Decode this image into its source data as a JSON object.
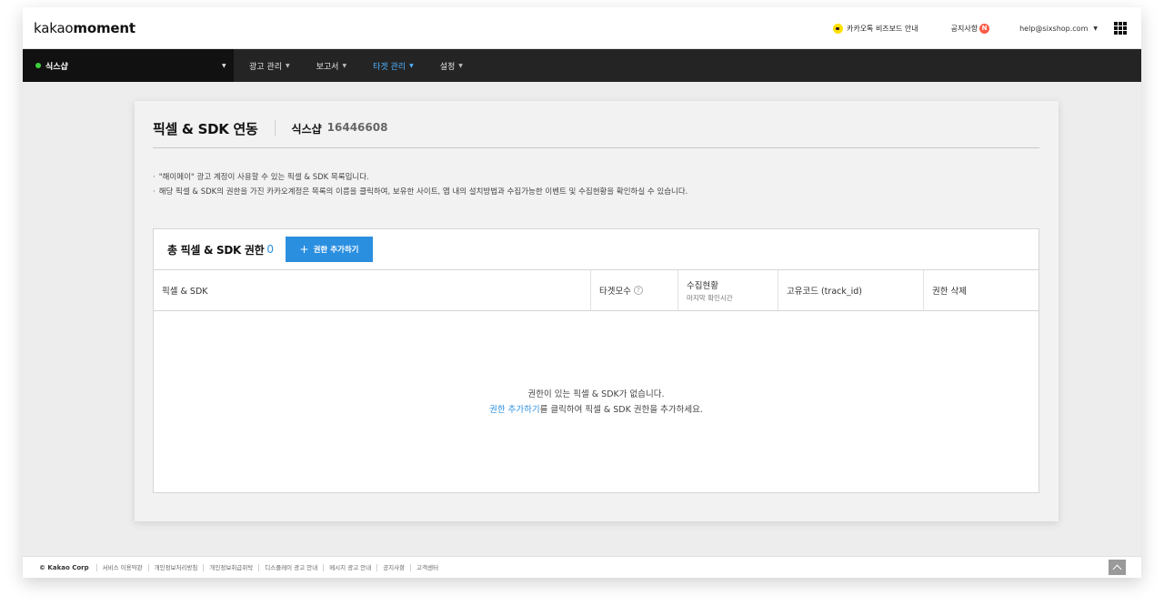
{
  "header": {
    "logo_regular": "kakao",
    "logo_bold": "moment",
    "biz_board_label": "카카오톡 비즈보드 안내",
    "notice_label": "공지사항",
    "notice_badge": "N",
    "account_email": "help@sixshop.com"
  },
  "nav": {
    "account_name": "식스샵",
    "items": [
      {
        "label": "광고 관리",
        "active": false
      },
      {
        "label": "보고서",
        "active": false
      },
      {
        "label": "타겟 관리",
        "active": true
      },
      {
        "label": "설정",
        "active": false
      }
    ]
  },
  "page": {
    "title": "픽셀 & SDK 연동",
    "account_name": "식스샵",
    "account_id": "16446608",
    "descriptions": [
      "\"해이메이\" 광고 계정이 사용할 수 있는 픽셀 & SDK 목록입니다.",
      "해당 픽셀 & SDK의 권한을 가진 카카오계정은 목록의 이름을 클릭하여, 보유한 사이트, 앱 내의 설치방법과 수집가능한 이벤트 및 수집현황을 확인하실 수 있습니다."
    ]
  },
  "table": {
    "title": "총 픽셀 & SDK 권한",
    "count": "0",
    "add_button": "권한 추가하기",
    "columns": {
      "name": "픽셀 & SDK",
      "target": "타겟모수",
      "status": "수집현황",
      "status_sub": "마지막 확인시간",
      "track_id": "고유코드 (track_id)",
      "delete": "권한 삭제"
    },
    "empty_line1": "권한이 있는 픽셀 & SDK가 없습니다.",
    "empty_link": "권한 추가하기",
    "empty_line2_rest": "를 클릭하여 픽셀 & SDK 권한을 추가하세요."
  },
  "footer": {
    "copyright": "© Kakao Corp",
    "links": [
      "서비스 이용약관",
      "개인정보처리방침",
      "개인정보취급위탁",
      "디스플레이 광고 안내",
      "메시지 광고 안내",
      "공지사항",
      "고객센터"
    ]
  },
  "colors": {
    "accent": "#2b8fe0",
    "nav_bg": "#242424",
    "nav_active": "#4fb2ff"
  }
}
